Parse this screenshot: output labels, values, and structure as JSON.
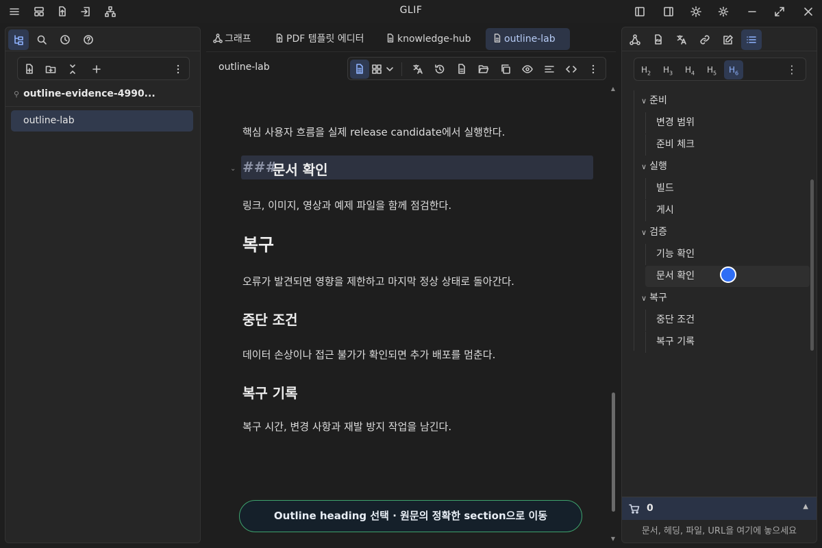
{
  "app": {
    "title": "GLIF"
  },
  "left": {
    "vault_name": "outline-evidence-4990...",
    "files": [
      {
        "label": "outline-lab"
      }
    ]
  },
  "tabs": [
    {
      "label": "그래프",
      "icon": "graph-icon"
    },
    {
      "label": "PDF 템플릿 에디터",
      "icon": "file-export-icon"
    },
    {
      "label": "knowledge-hub",
      "icon": "document-icon"
    },
    {
      "label": "outline-lab",
      "icon": "document-icon",
      "active": true
    }
  ],
  "doc": {
    "title": "outline-lab",
    "blocks": [
      {
        "type": "p",
        "text": "핵심 사용자 흐름을 실제 release candidate에서 실행한다."
      },
      {
        "type": "h3",
        "marker": "###",
        "text": "문서 확인"
      },
      {
        "type": "p",
        "text": "링크, 이미지, 영상과 예제 파일을 함께 점검한다."
      },
      {
        "type": "h1",
        "text": "복구"
      },
      {
        "type": "p",
        "text": "오류가 발견되면 영향을 제한하고 마지막 정상 상태로 돌아간다."
      },
      {
        "type": "h2",
        "text": "중단 조건"
      },
      {
        "type": "p",
        "text": "데이터 손상이나 접근 불가가 확인되면 추가 배포를 멈춘다."
      },
      {
        "type": "h2",
        "text": "복구 기록"
      },
      {
        "type": "p",
        "text": "복구 시간, 변경 사항과 재발 방지 작업을 남긴다."
      }
    ]
  },
  "toast": {
    "text": "Outline heading 선택 · 원문의 정확한 section으로 이동"
  },
  "right": {
    "heading_levels": [
      {
        "letter": "H",
        "sub": "2"
      },
      {
        "letter": "H",
        "sub": "3"
      },
      {
        "letter": "H",
        "sub": "4"
      },
      {
        "letter": "H",
        "sub": "5"
      },
      {
        "letter": "H",
        "sub": "6",
        "active": true
      }
    ],
    "outline": [
      {
        "label": "준비",
        "level": "group"
      },
      {
        "label": "변경 범위",
        "level": "child"
      },
      {
        "label": "준비 체크",
        "level": "child"
      },
      {
        "label": "실행",
        "level": "group"
      },
      {
        "label": "빌드",
        "level": "child"
      },
      {
        "label": "게시",
        "level": "child"
      },
      {
        "label": "검증",
        "level": "group"
      },
      {
        "label": "기능 확인",
        "level": "child"
      },
      {
        "label": "문서 확인",
        "level": "child",
        "selected": true
      },
      {
        "label": "복구",
        "level": "group"
      },
      {
        "label": "중단 조건",
        "level": "child"
      },
      {
        "label": "복구 기록",
        "level": "child"
      }
    ],
    "cart_count": "0",
    "drop_hint": "문서, 헤딩, 파일, URL을 여기에 놓으세요"
  },
  "colors": {
    "accent": "#8fb3ff",
    "toast_border": "#3ea46e",
    "cursor": "#2f6ef5"
  }
}
